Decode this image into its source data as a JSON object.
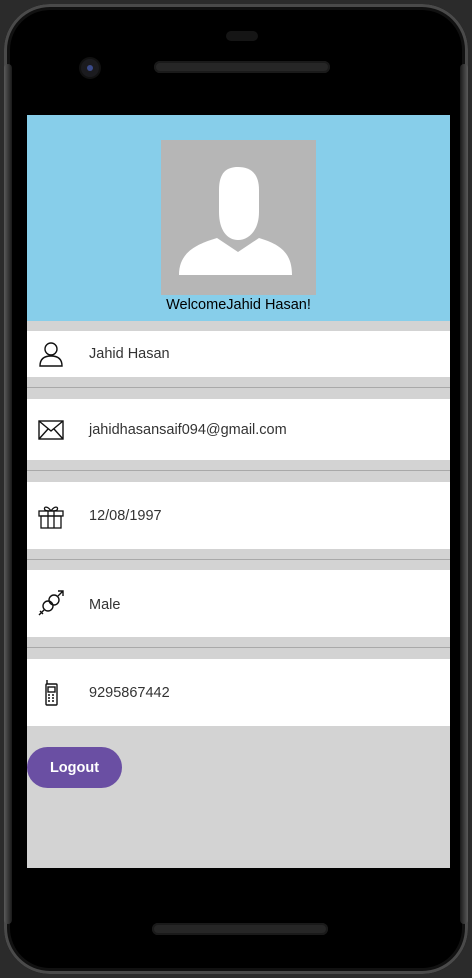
{
  "profile": {
    "welcome_text": "WelcomeJahid Hasan!",
    "avatar_icon": "person-placeholder-icon"
  },
  "fields": {
    "name": {
      "icon": "person-icon",
      "value": "Jahid Hasan"
    },
    "email": {
      "icon": "envelope-icon",
      "value": "jahidhasansaif094@gmail.com"
    },
    "birthday": {
      "icon": "gift-icon",
      "value": "12/08/1997"
    },
    "gender": {
      "icon": "gender-icon",
      "value": "Male"
    },
    "phone": {
      "icon": "mobile-phone-icon",
      "value": "9295867442"
    }
  },
  "actions": {
    "logout_label": "Logout"
  },
  "colors": {
    "header_bg": "#87ceea",
    "screen_bg": "#d3d3d3",
    "logout_bg": "#6a4fa3",
    "avatar_bg": "#b6b6b6"
  }
}
